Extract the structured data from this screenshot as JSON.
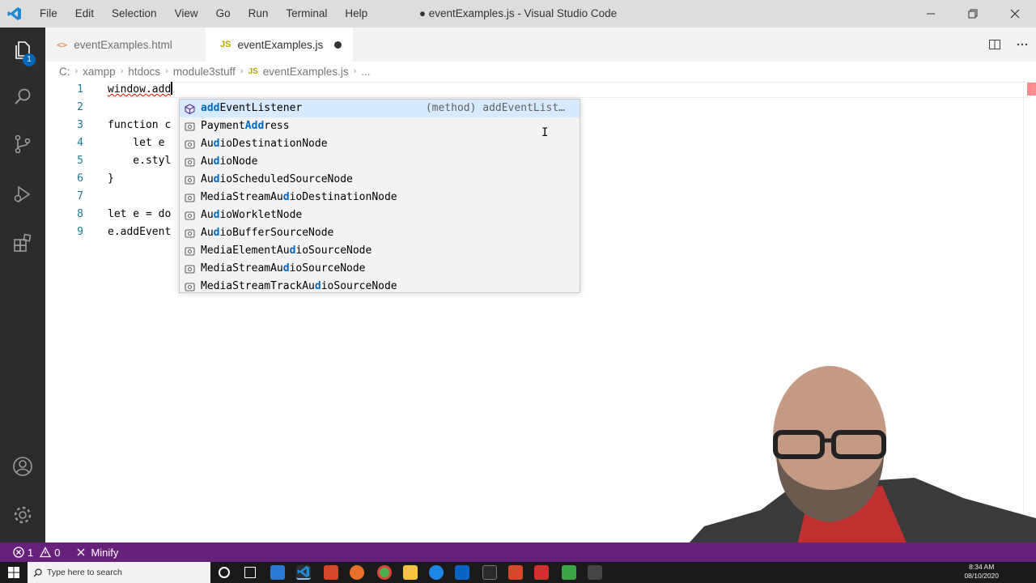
{
  "window": {
    "title": "● eventExamples.js - Visual Studio Code",
    "menu": [
      "File",
      "Edit",
      "Selection",
      "View",
      "Go",
      "Run",
      "Terminal",
      "Help"
    ]
  },
  "activity": {
    "explorer_badge": "1"
  },
  "tabs": [
    {
      "label": "eventExamples.html",
      "icon": "<>"
    },
    {
      "label": "eventExamples.js",
      "icon": "JS",
      "modified": true
    }
  ],
  "breadcrumb": [
    "C:",
    "xampp",
    "htdocs",
    "module3stuff",
    "eventExamples.js",
    "..."
  ],
  "breadcrumb_file_icon": "JS",
  "editor": {
    "lines": [
      {
        "n": "1",
        "text": "window.add"
      },
      {
        "n": "2",
        "text": ""
      },
      {
        "n": "3",
        "text": "function c"
      },
      {
        "n": "4",
        "text": "    let e "
      },
      {
        "n": "5",
        "text": "    e.styl"
      },
      {
        "n": "6",
        "text": "}"
      },
      {
        "n": "7",
        "text": ""
      },
      {
        "n": "8",
        "text": "let e = do"
      },
      {
        "n": "9",
        "text": "e.addEvent"
      }
    ]
  },
  "suggest": {
    "items": [
      {
        "pre": "",
        "match": "add",
        "post": "EventListener",
        "detail": "(method) addEventList…",
        "kind": "method"
      },
      {
        "pre": "Payment",
        "match": "Add",
        "post": "ress",
        "kind": "property"
      },
      {
        "pre": "Au",
        "match": "d",
        "post": "ioDestinationNode",
        "kind": "property"
      },
      {
        "pre": "Au",
        "match": "d",
        "post": "ioNode",
        "kind": "property"
      },
      {
        "pre": "Au",
        "match": "d",
        "post": "ioScheduledSourceNode",
        "kind": "property"
      },
      {
        "pre": "MediaStreamAu",
        "match": "d",
        "post": "ioDestinationNode",
        "kind": "property"
      },
      {
        "pre": "Au",
        "match": "d",
        "post": "ioWorkletNode",
        "kind": "property"
      },
      {
        "pre": "Au",
        "match": "d",
        "post": "ioBufferSourceNode",
        "kind": "property"
      },
      {
        "pre": "MediaElementAu",
        "match": "d",
        "post": "ioSourceNode",
        "kind": "property"
      },
      {
        "pre": "MediaStreamAu",
        "match": "d",
        "post": "ioSourceNode",
        "kind": "property"
      },
      {
        "pre": "MediaStreamTrackAu",
        "match": "d",
        "post": "ioSourceNode",
        "kind": "property"
      }
    ]
  },
  "status": {
    "errors": "1",
    "warnings": "0",
    "minify": "Minify"
  },
  "taskbar": {
    "search_placeholder": "Type here to search",
    "time": "8:34 AM",
    "date": "08/10/2020"
  },
  "colors": {
    "statusbar": "#68217a",
    "activitybar": "#2c2c2c",
    "titlebar": "#dddddd",
    "accent": "#0066b8"
  }
}
